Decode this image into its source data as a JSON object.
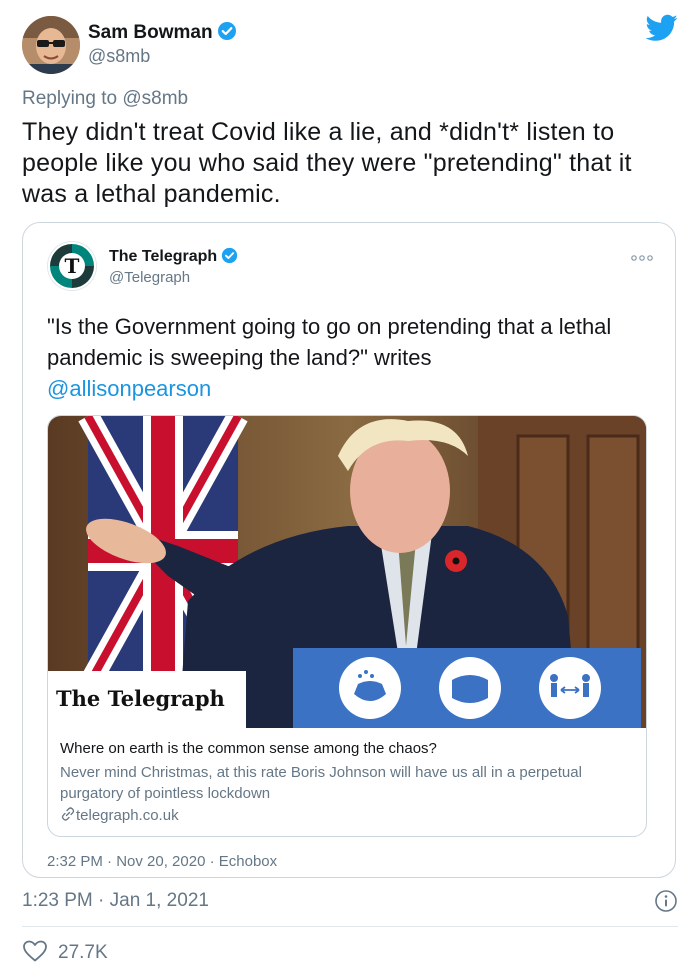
{
  "author": {
    "name": "Sam Bowman",
    "handle": "@s8mb",
    "avatar_icon": "user-avatar-photo",
    "verified_icon": "verified-badge-icon"
  },
  "replying": {
    "prefix": "Replying to ",
    "mention": "@s8mb"
  },
  "tweet": {
    "text": "They didn't treat Covid like a lie, and *didn't* listen to people like you who said they were \"pretending\" that it was a lethal pandemic.",
    "timestamp": "1:23 PM · Jan 1, 2021",
    "likes": "27.7K"
  },
  "quoted": {
    "name": "The Telegraph",
    "handle": "@Telegraph",
    "text": "\"Is the Government going to go on pretending that a lethal pandemic is sweeping the land?\" writes",
    "link": "@allisonpearson",
    "timestamp": "2:32 PM · Nov 20, 2020 · Echobox",
    "card": {
      "image_caption": "The Telegraph",
      "title": "Where on earth is the common sense among the chaos?",
      "description": "Never mind Christmas, at this rate Boris Johnson will have us all in a perpetual purgatory of pointless lockdown",
      "url": "telegraph.co.uk"
    }
  },
  "colors": {
    "brand_blue": "#1da1f2",
    "link": "#1b95e0",
    "muted": "#657786",
    "telegraph_teal": "#00857d"
  }
}
